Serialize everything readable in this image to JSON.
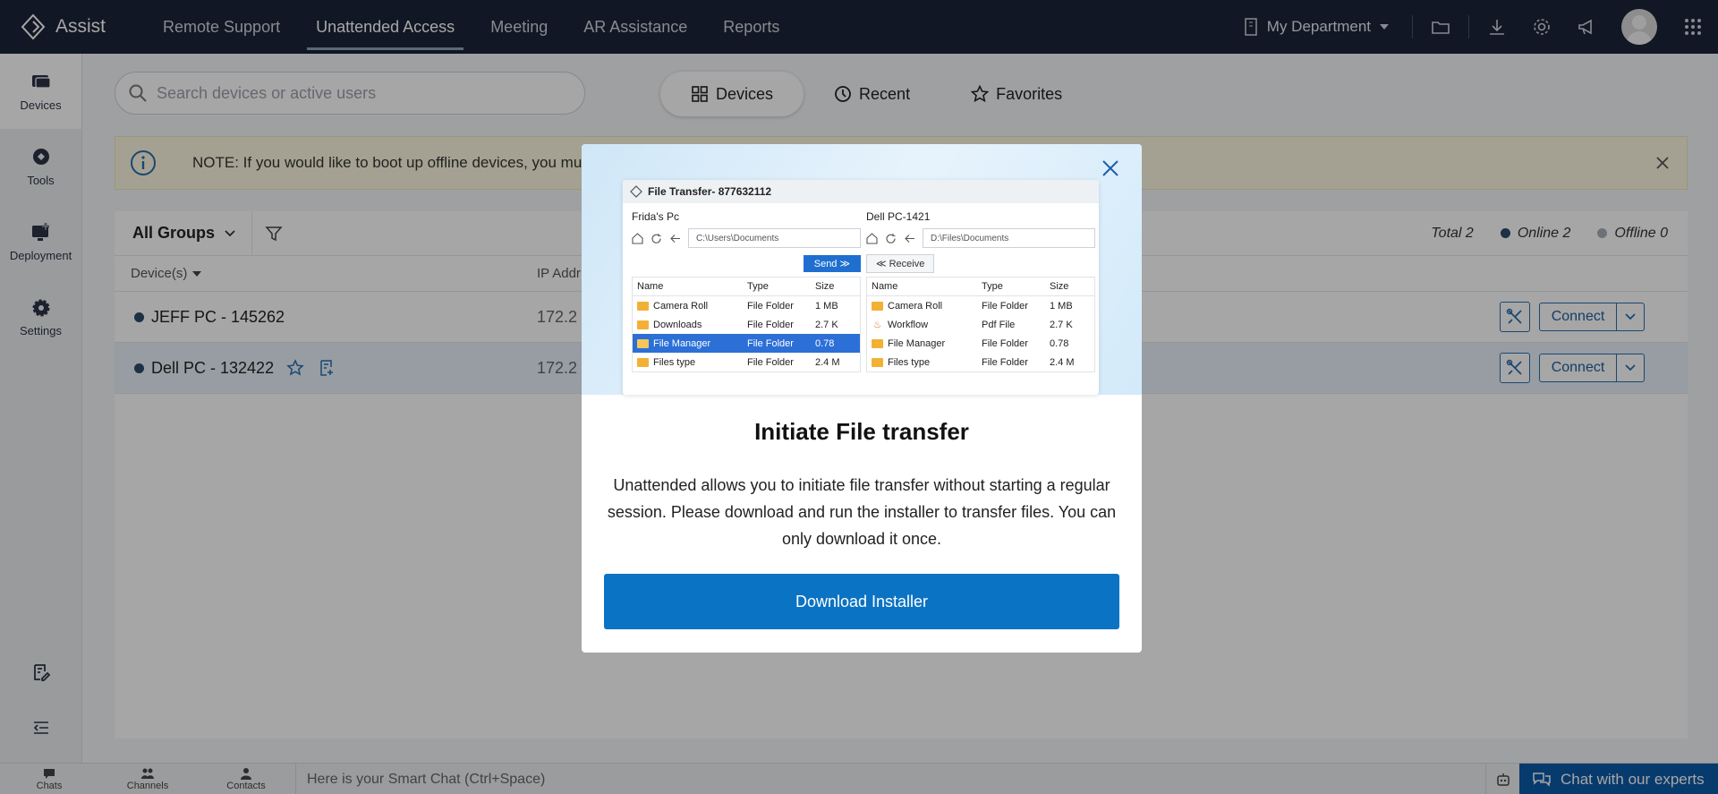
{
  "app": {
    "name": "Assist"
  },
  "nav": {
    "items": [
      {
        "label": "Remote Support",
        "active": false
      },
      {
        "label": "Unattended Access",
        "active": true
      },
      {
        "label": "Meeting",
        "active": false
      },
      {
        "label": "AR Assistance",
        "active": false
      },
      {
        "label": "Reports",
        "active": false
      }
    ],
    "department": "My Department"
  },
  "sidebar": {
    "items": [
      {
        "label": "Devices",
        "icon": "devices-icon",
        "active": true
      },
      {
        "label": "Tools",
        "icon": "tools-icon"
      },
      {
        "label": "Deployment",
        "icon": "deployment-icon"
      },
      {
        "label": "Settings",
        "icon": "gear-icon"
      }
    ]
  },
  "search": {
    "placeholder": "Search devices or active users"
  },
  "view_tabs": [
    {
      "label": "Devices",
      "icon": "grid-icon",
      "active": true
    },
    {
      "label": "Recent",
      "icon": "clock-icon"
    },
    {
      "label": "Favorites",
      "icon": "star-icon"
    }
  ],
  "note": {
    "text": "NOTE: If you would like to boot up offline devices, you mu"
  },
  "devices": {
    "group_label": "All Groups",
    "total": "Total 2",
    "online": "Online 2",
    "offline": "Offline 0",
    "col_device": "Device(s)",
    "col_ip": "IP Addr",
    "rows": [
      {
        "name": "JEFF PC - 145262",
        "ip": "172.2",
        "action": "Connect"
      },
      {
        "name": "Dell PC - 132422",
        "ip": "172.2",
        "action": "Connect"
      }
    ]
  },
  "bottom": {
    "chats": "Chats",
    "channels": "Channels",
    "contacts": "Contacts",
    "smart_chat": "Here is your Smart Chat (Ctrl+Space)",
    "experts": "Chat with our experts"
  },
  "modal": {
    "title": "Initiate File transfer",
    "text": "Unattended allows you to initiate file transfer without starting a regular session. Please download and run the installer to transfer files. You can only download it once.",
    "button": "Download Installer",
    "preview": {
      "window_title": "File Transfer- 877632112",
      "left_pc": "Frida's Pc",
      "left_path": "C:\\Users\\Documents",
      "send": "Send ≫",
      "right_pc": "Dell PC-1421",
      "right_path": "D:\\Files\\Documents",
      "receive": "≪ Receive",
      "headers": {
        "name": "Name",
        "type": "Type",
        "size": "Size"
      },
      "left_files": [
        {
          "name": "Camera Roll",
          "type": "File Folder",
          "size": "1 MB"
        },
        {
          "name": "Downloads",
          "type": "File Folder",
          "size": "2.7 K"
        },
        {
          "name": "File Manager",
          "type": "File Folder",
          "size": "0.78"
        },
        {
          "name": "Files type",
          "type": "File Folder",
          "size": "2.4 M"
        }
      ],
      "right_files": [
        {
          "name": "Camera Roll",
          "type": "File Folder",
          "size": "1 MB"
        },
        {
          "name": "Workflow",
          "type": "Pdf File",
          "size": "2.7 K"
        },
        {
          "name": "File Manager",
          "type": "File Folder",
          "size": "0.78"
        },
        {
          "name": "Files type",
          "type": "File Folder",
          "size": "2.4 M"
        }
      ]
    }
  },
  "colors": {
    "nav_bg": "#1b2438",
    "primary": "#0b73c3",
    "online": "#2e4a6b",
    "offline": "#aab0b8"
  }
}
